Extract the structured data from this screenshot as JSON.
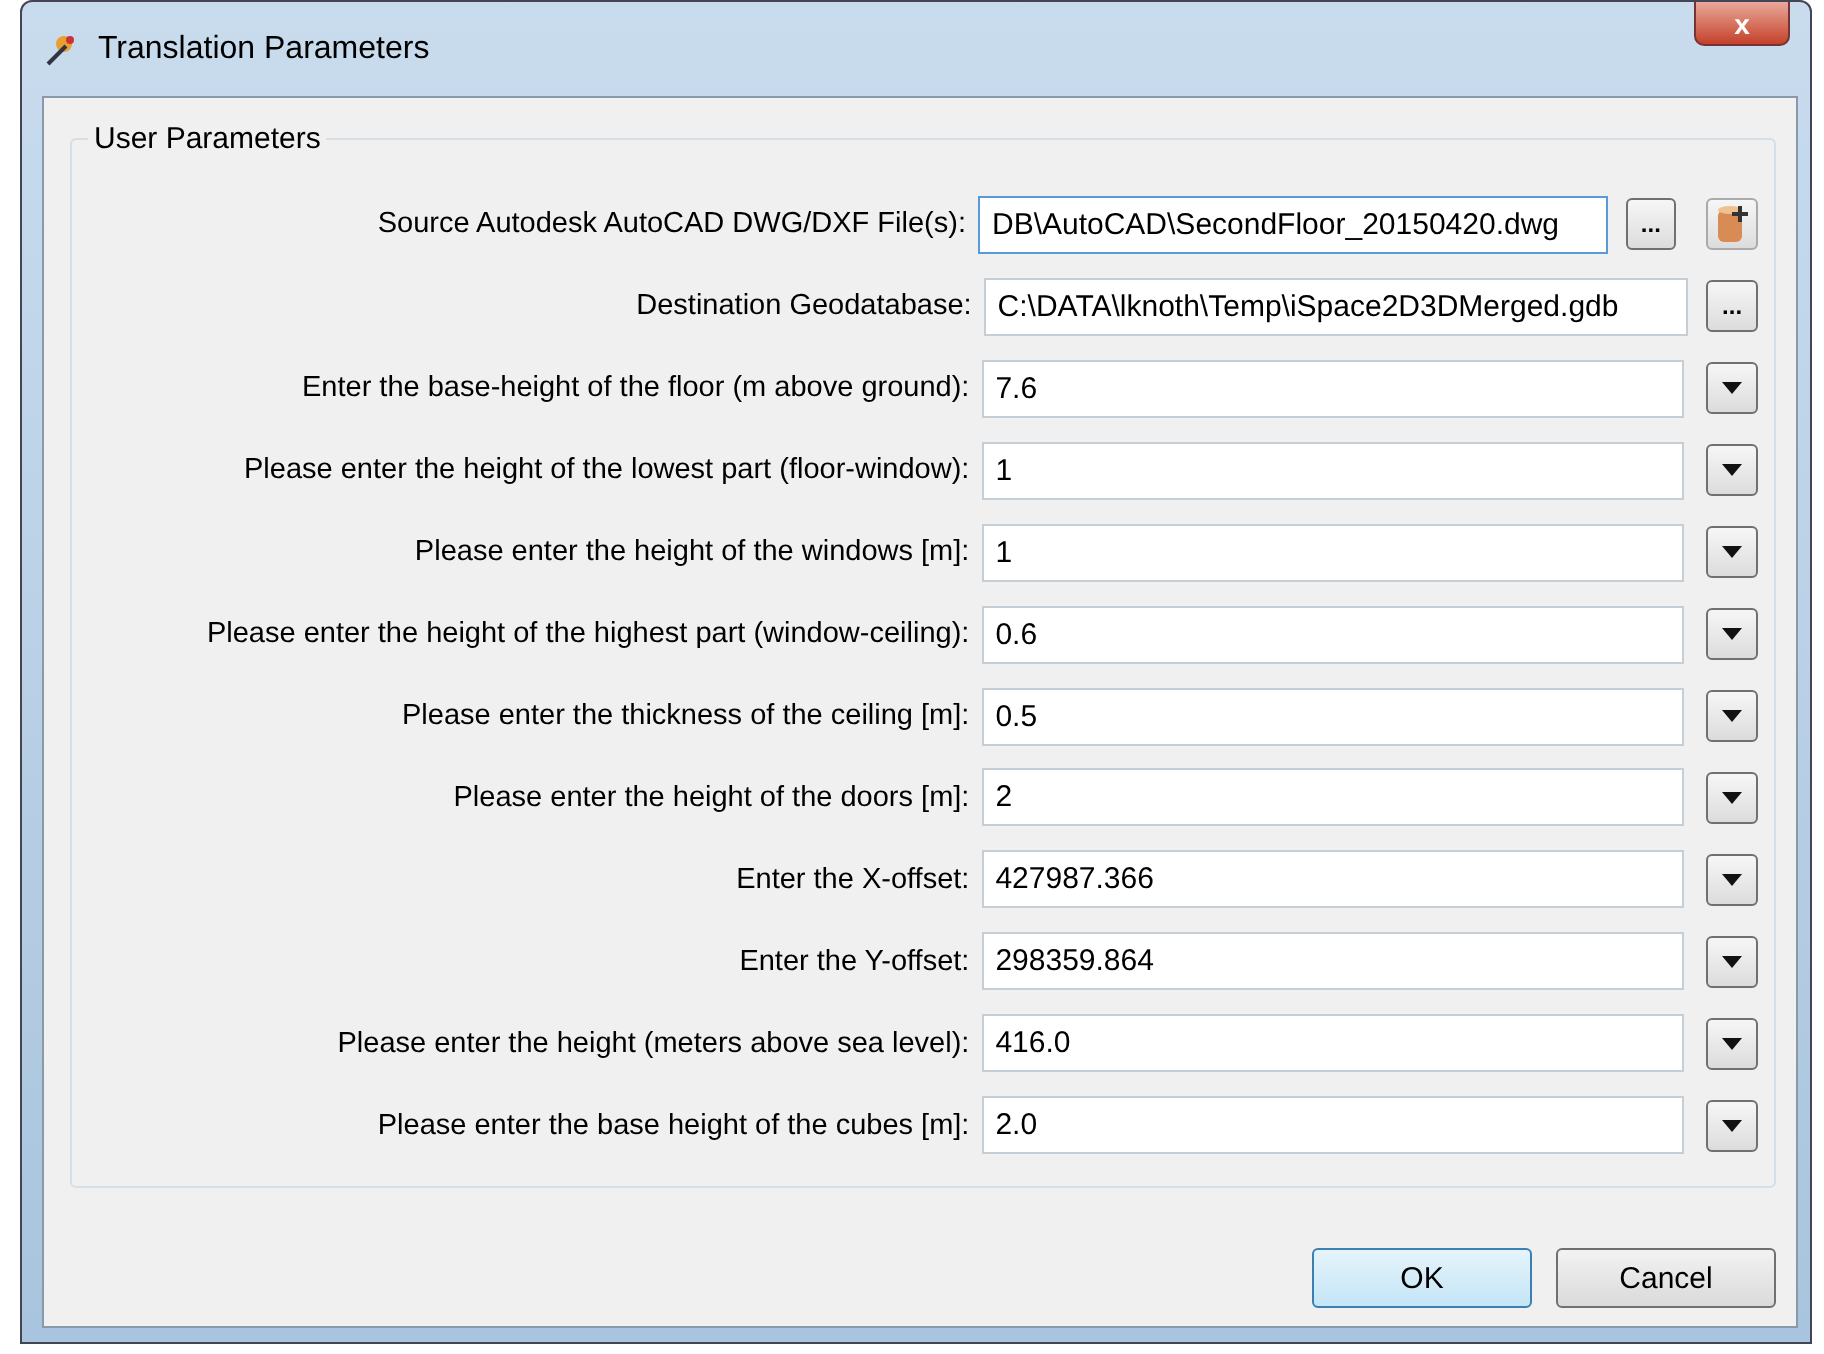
{
  "window": {
    "title": "Translation Parameters",
    "close_label": "x"
  },
  "group": {
    "title": "User Parameters"
  },
  "parameters": [
    {
      "kind": "file",
      "label": "Source Autodesk AutoCAD DWG/DXF File(s):",
      "value": "DB\\AutoCAD\\SecondFloor_20150420.dwg",
      "browse": "...",
      "focused": true
    },
    {
      "kind": "folder",
      "label": "Destination Geodatabase:",
      "value": "C:\\DATA\\lknoth\\Temp\\iSpace2D3DMerged.gdb",
      "browse": "...",
      "focused": false
    },
    {
      "kind": "choice",
      "label": "Enter the base-height of the floor (m above ground):",
      "value": "7.6",
      "focused": false
    },
    {
      "kind": "choice",
      "label": "Please enter the height of the lowest part (floor-window):",
      "value": "1",
      "focused": false
    },
    {
      "kind": "choice",
      "label": "Please enter the height of the windows [m]:",
      "value": "1",
      "focused": false
    },
    {
      "kind": "choice",
      "label": "Please enter the height of the highest part (window-ceiling):",
      "value": "0.6",
      "focused": false
    },
    {
      "kind": "choice",
      "label": "Please enter the thickness of the ceiling [m]:",
      "value": "0.5",
      "focused": false
    },
    {
      "kind": "choice",
      "label": "Please enter the height of the doors [m]:",
      "value": "2",
      "focused": false
    },
    {
      "kind": "choice",
      "label": "Enter the X-offset:",
      "value": "427987.366",
      "focused": false
    },
    {
      "kind": "choice",
      "label": "Enter the Y-offset:",
      "value": "298359.864",
      "focused": false
    },
    {
      "kind": "choice",
      "label": "Please enter the height (meters above sea level):",
      "value": "416.0",
      "focused": false
    },
    {
      "kind": "choice",
      "label": "Please enter the base height of the cubes [m]:",
      "value": "2.0",
      "focused": false
    }
  ],
  "buttons": [
    {
      "label": "OK",
      "default": true
    },
    {
      "label": "Cancel",
      "default": false
    }
  ]
}
